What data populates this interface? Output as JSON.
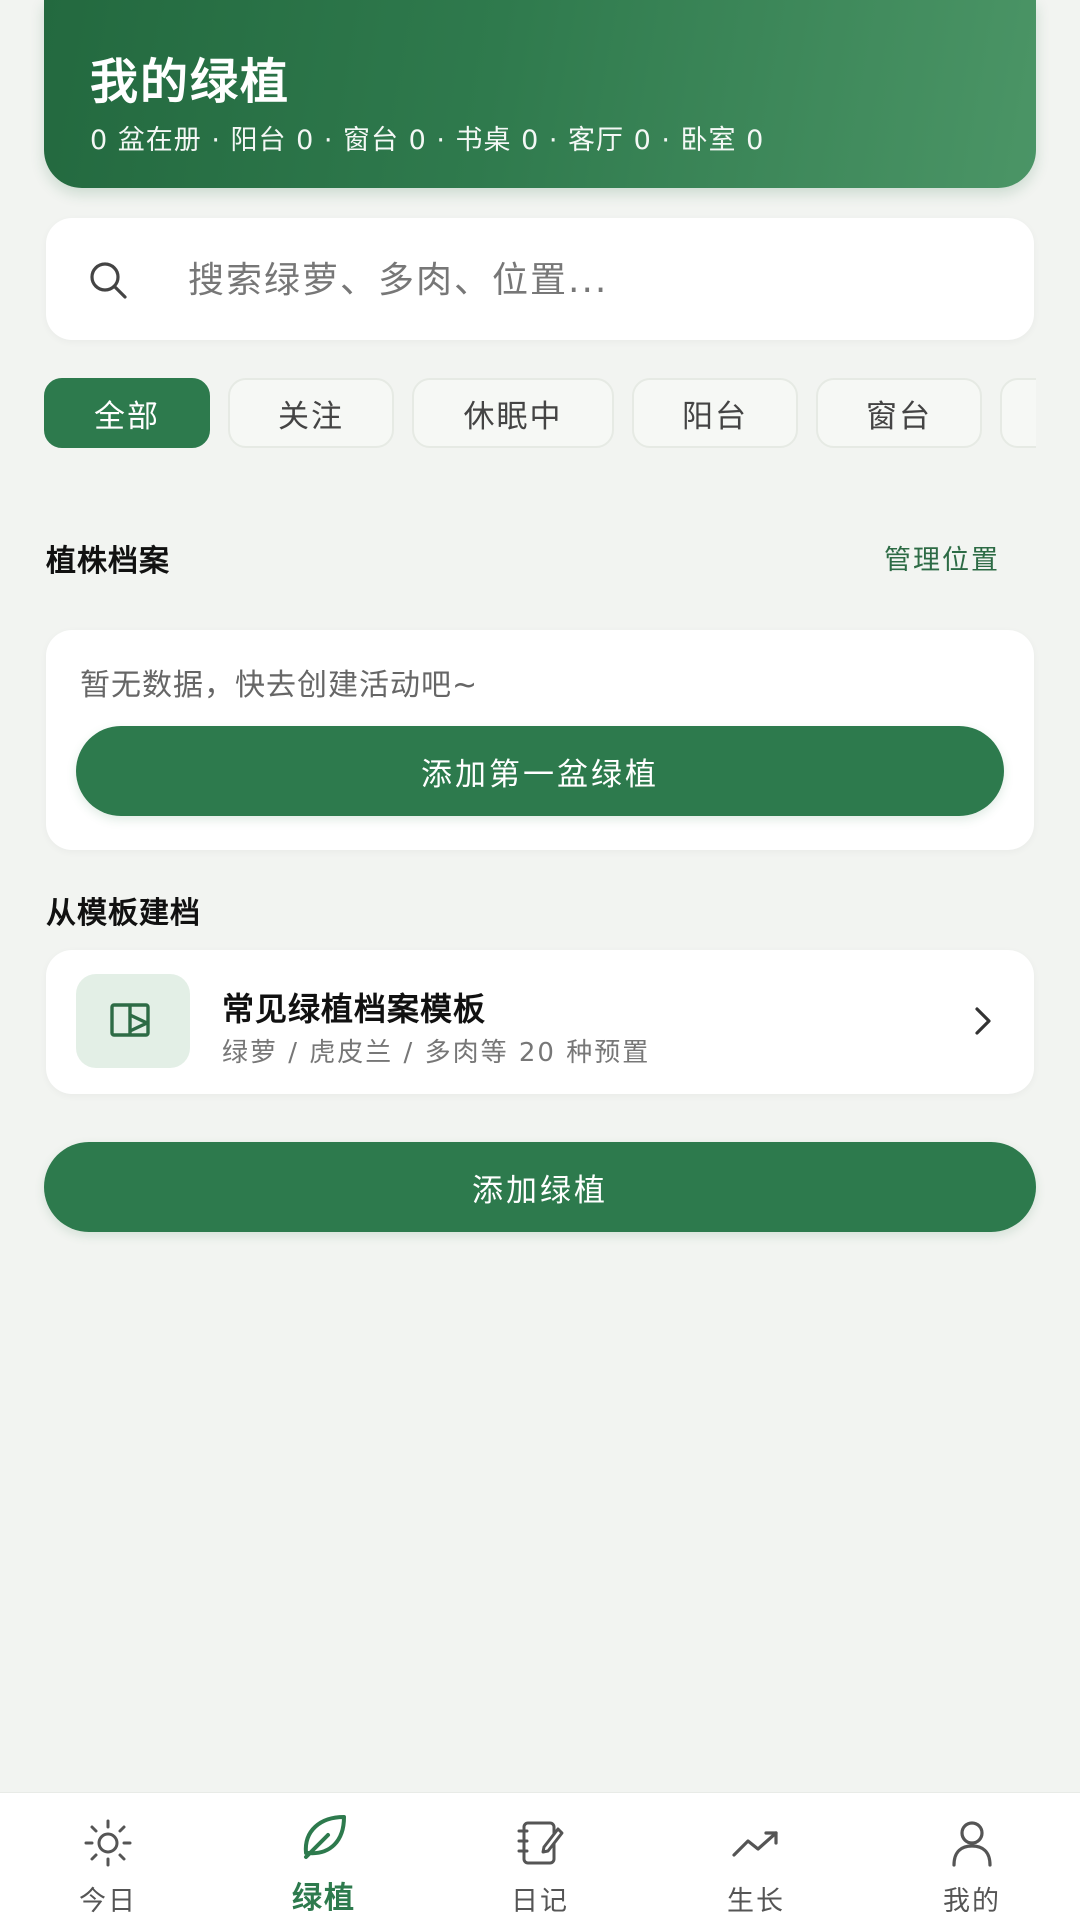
{
  "header": {
    "title": "我的绿植",
    "summary": "0 盆在册 · 阳台 0 · 窗台 0 · 书桌 0 · 客厅 0 · 卧室 0"
  },
  "search": {
    "icon": "search-icon",
    "placeholder": "搜索绿萝、多肉、位置..."
  },
  "filters": [
    "全部",
    "关注",
    "休眠中",
    "阳台",
    "窗台"
  ],
  "active_filter": "全部",
  "plants_section": {
    "title": "植株档案",
    "manage_link": "管理位置",
    "empty_text": "暂无数据，快去创建活动吧~",
    "add_first_button": "添加第一盆绿植"
  },
  "template_section": {
    "title": "从模板建档",
    "item": {
      "icon": "template-book-icon",
      "title": "常见绿植档案模板",
      "subtitle": "绿萝 / 虎皮兰 / 多肉等 20 种预置",
      "chevron": "chevron-right-icon"
    }
  },
  "add_button": "添加绿植",
  "tabbar": [
    {
      "label": "今日",
      "icon": "sun-icon",
      "active": false
    },
    {
      "label": "绿植",
      "icon": "leaf-icon",
      "active": true
    },
    {
      "label": "日记",
      "icon": "notebook-icon",
      "active": false
    },
    {
      "label": "生长",
      "icon": "trend-up-icon",
      "active": false
    },
    {
      "label": "我的",
      "icon": "user-icon",
      "active": false
    }
  ],
  "colors": {
    "primary": "#2d7a4d",
    "background": "#f2f4f1"
  }
}
